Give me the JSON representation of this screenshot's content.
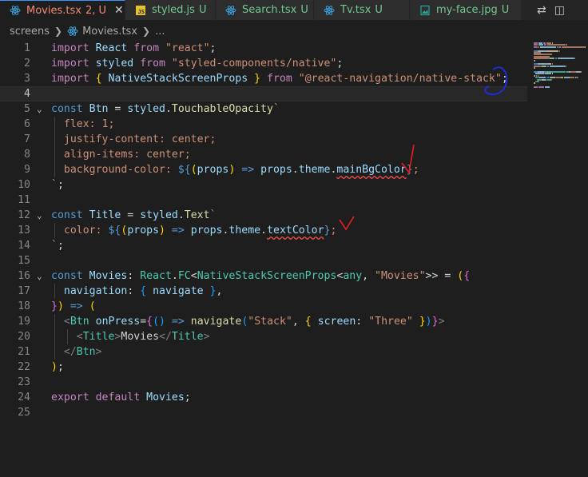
{
  "tabs": [
    {
      "name": "Movies.tsx",
      "status": "2, U",
      "icon": "react-icon",
      "active": true,
      "close": "✕"
    },
    {
      "name": "styled.js",
      "status": "U",
      "icon": "js-icon",
      "active": false
    },
    {
      "name": "Search.tsx",
      "status": "U",
      "icon": "react-icon",
      "active": false
    },
    {
      "name": "Tv.tsx",
      "status": "U",
      "icon": "react-icon",
      "active": false
    },
    {
      "name": "my-face.jpg",
      "status": "U",
      "icon": "image-icon",
      "active": false
    }
  ],
  "js_badge": "JS",
  "breadcrumb": {
    "folder": "screens",
    "file": "Movies.tsx",
    "more": "..."
  },
  "editor": {
    "current_line": 4,
    "lines": [
      [
        [
          "kw",
          "import"
        ],
        [
          "txt",
          " "
        ],
        [
          "var",
          "React"
        ],
        [
          "txt",
          " "
        ],
        [
          "kw",
          "from"
        ],
        [
          "txt",
          " "
        ],
        [
          "str",
          "\"react\""
        ],
        [
          "txt",
          ";"
        ]
      ],
      [
        [
          "kw",
          "import"
        ],
        [
          "txt",
          " "
        ],
        [
          "var",
          "styled"
        ],
        [
          "txt",
          " "
        ],
        [
          "kw",
          "from"
        ],
        [
          "txt",
          " "
        ],
        [
          "str",
          "\"styled-components/native\""
        ],
        [
          "txt",
          ";"
        ]
      ],
      [
        [
          "kw",
          "import"
        ],
        [
          "txt",
          " "
        ],
        [
          "br1",
          "{"
        ],
        [
          "txt",
          " "
        ],
        [
          "var",
          "NativeStackScreenProps"
        ],
        [
          "txt",
          " "
        ],
        [
          "br1",
          "}"
        ],
        [
          "txt",
          " "
        ],
        [
          "kw",
          "from"
        ],
        [
          "txt",
          " "
        ],
        [
          "str",
          "\"@react-navigation/native-stack\""
        ],
        [
          "txt",
          ";"
        ]
      ],
      [],
      [
        [
          "dec",
          "const"
        ],
        [
          "txt",
          " "
        ],
        [
          "var",
          "Btn"
        ],
        [
          "txt",
          " = "
        ],
        [
          "var",
          "styled"
        ],
        [
          "txt",
          "."
        ],
        [
          "fn",
          "TouchableOpacity"
        ],
        [
          "tmp",
          "`"
        ]
      ],
      [
        [
          "tmp",
          "  flex: 1;"
        ]
      ],
      [
        [
          "tmp",
          "  justify-content: center;"
        ]
      ],
      [
        [
          "tmp",
          "  align-items: center;"
        ]
      ],
      [
        [
          "tmp",
          "  background-color: "
        ],
        [
          "dec",
          "${"
        ],
        [
          "br1",
          "("
        ],
        [
          "var",
          "props"
        ],
        [
          "br1",
          ")"
        ],
        [
          "txt",
          " "
        ],
        [
          "dec",
          "=>"
        ],
        [
          "txt",
          " "
        ],
        [
          "var",
          "props"
        ],
        [
          "txt",
          "."
        ],
        [
          "var",
          "theme"
        ],
        [
          "txt",
          "."
        ],
        [
          "var",
          "mainBgColor",
          "squig"
        ],
        [
          "dec",
          "}"
        ],
        [
          "tmp",
          ";"
        ]
      ],
      [
        [
          "tmp",
          "`"
        ],
        [
          "txt",
          ";"
        ]
      ],
      [],
      [
        [
          "dec",
          "const"
        ],
        [
          "txt",
          " "
        ],
        [
          "var",
          "Title"
        ],
        [
          "txt",
          " = "
        ],
        [
          "var",
          "styled"
        ],
        [
          "txt",
          "."
        ],
        [
          "fn",
          "Text"
        ],
        [
          "tmp",
          "`"
        ]
      ],
      [
        [
          "tmp",
          "  color: "
        ],
        [
          "dec",
          "${"
        ],
        [
          "br1",
          "("
        ],
        [
          "var",
          "props"
        ],
        [
          "br1",
          ")"
        ],
        [
          "txt",
          " "
        ],
        [
          "dec",
          "=>"
        ],
        [
          "txt",
          " "
        ],
        [
          "var",
          "props"
        ],
        [
          "txt",
          "."
        ],
        [
          "var",
          "theme"
        ],
        [
          "txt",
          "."
        ],
        [
          "var",
          "textColor",
          "squig"
        ],
        [
          "dec",
          "}"
        ],
        [
          "tmp",
          ";"
        ]
      ],
      [
        [
          "tmp",
          "`"
        ],
        [
          "txt",
          ";"
        ]
      ],
      [],
      [
        [
          "dec",
          "const"
        ],
        [
          "txt",
          " "
        ],
        [
          "var",
          "Movies"
        ],
        [
          "txt",
          ": "
        ],
        [
          "cls",
          "React"
        ],
        [
          "txt",
          "."
        ],
        [
          "cls",
          "FC"
        ],
        [
          "txt",
          "<"
        ],
        [
          "cls",
          "NativeStackScreenProps"
        ],
        [
          "txt",
          "<"
        ],
        [
          "cls",
          "any"
        ],
        [
          "txt",
          ", "
        ],
        [
          "str",
          "\"Movies\""
        ],
        [
          "txt",
          ">> = "
        ],
        [
          "br1",
          "("
        ],
        [
          "br2",
          "{"
        ]
      ],
      [
        [
          "txt",
          "  "
        ],
        [
          "var",
          "navigation"
        ],
        [
          "txt",
          ": "
        ],
        [
          "br3",
          "{"
        ],
        [
          "txt",
          " "
        ],
        [
          "var",
          "navigate"
        ],
        [
          "txt",
          " "
        ],
        [
          "br3",
          "}"
        ],
        [
          "txt",
          ","
        ]
      ],
      [
        [
          "br2",
          "}"
        ],
        [
          "br1",
          ")"
        ],
        [
          "txt",
          " "
        ],
        [
          "dec",
          "=>"
        ],
        [
          "txt",
          " "
        ],
        [
          "br1",
          "("
        ]
      ],
      [
        [
          "txt",
          "  "
        ],
        [
          "tgp",
          "<"
        ],
        [
          "tag",
          "Btn"
        ],
        [
          "txt",
          " "
        ],
        [
          "var",
          "onPress"
        ],
        [
          "txt",
          "="
        ],
        [
          "br2",
          "{"
        ],
        [
          "br3",
          "()"
        ],
        [
          "txt",
          " "
        ],
        [
          "dec",
          "=>"
        ],
        [
          "txt",
          " "
        ],
        [
          "fn",
          "navigate"
        ],
        [
          "br3",
          "("
        ],
        [
          "str",
          "\"Stack\""
        ],
        [
          "txt",
          ", "
        ],
        [
          "br1",
          "{"
        ],
        [
          "txt",
          " "
        ],
        [
          "var",
          "screen"
        ],
        [
          "txt",
          ": "
        ],
        [
          "str",
          "\"Three\""
        ],
        [
          "txt",
          " "
        ],
        [
          "br1",
          "}"
        ],
        [
          "br3",
          ")"
        ],
        [
          "br2",
          "}"
        ],
        [
          "tgp",
          ">"
        ]
      ],
      [
        [
          "txt",
          "    "
        ],
        [
          "tgp",
          "<"
        ],
        [
          "tag",
          "Title"
        ],
        [
          "tgp",
          ">"
        ],
        [
          "txt",
          "Movies"
        ],
        [
          "tgp",
          "</"
        ],
        [
          "tag",
          "Title"
        ],
        [
          "tgp",
          ">"
        ]
      ],
      [
        [
          "txt",
          "  "
        ],
        [
          "tgp",
          "</"
        ],
        [
          "tag",
          "Btn"
        ],
        [
          "tgp",
          ">"
        ]
      ],
      [
        [
          "br1",
          ")"
        ],
        [
          "txt",
          ";"
        ]
      ],
      [],
      [
        [
          "kw",
          "export"
        ],
        [
          "txt",
          " "
        ],
        [
          "kw",
          "default"
        ],
        [
          "txt",
          " "
        ],
        [
          "var",
          "Movies"
        ],
        [
          "txt",
          ";"
        ]
      ],
      []
    ]
  },
  "colors": {
    "background": "#1e1e1e",
    "tab_active_border": "#3794ff",
    "untracked": "#73c991",
    "modified_error": "#f48771",
    "annotation_red": "#e81e1e",
    "annotation_blue": "#1f2bd8"
  }
}
